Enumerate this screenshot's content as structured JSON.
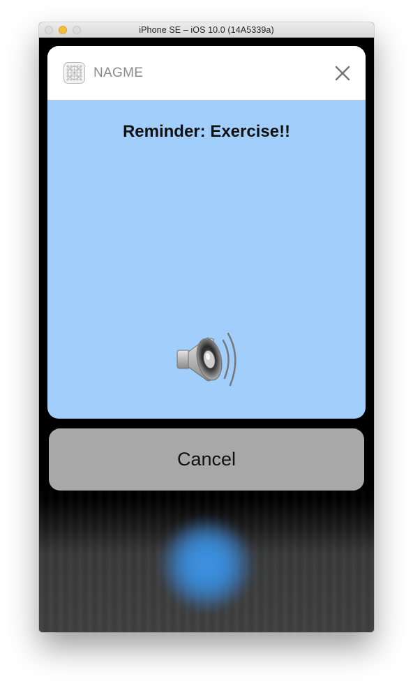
{
  "window": {
    "title": "iPhone SE – iOS 10.0 (14A5339a)"
  },
  "notification": {
    "app_name": "NAGME",
    "app_icon": "grid-icon",
    "close_icon": "close-icon",
    "message": "Reminder: Exercise!!",
    "media_icon": "speaker-icon",
    "background_color": "#a1cefb"
  },
  "actions": {
    "cancel_label": "Cancel"
  }
}
